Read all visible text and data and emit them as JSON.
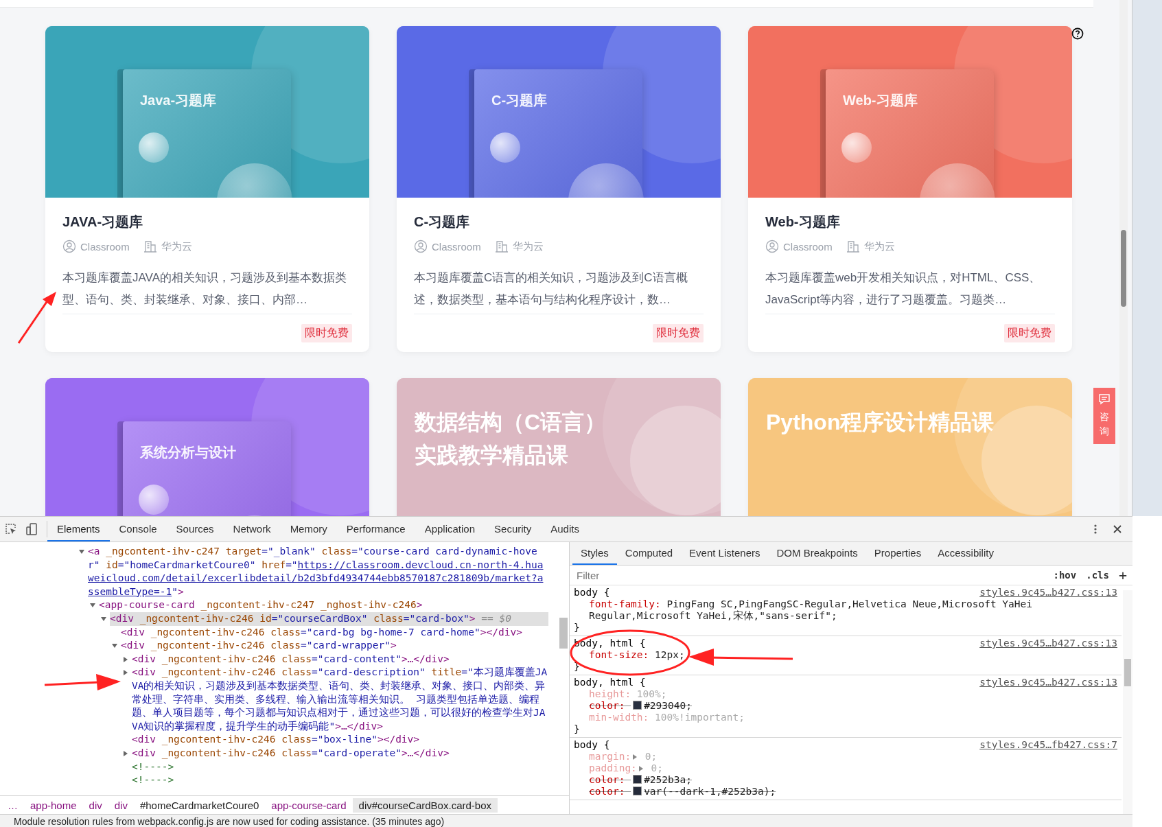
{
  "cards": [
    {
      "cover_lines": [
        "Java-习题库"
      ],
      "color": "#3aa5b8",
      "title": "JAVA-习题库",
      "author": "Classroom",
      "org": "华为云",
      "description": "本习题库覆盖JAVA的相关知识，习题涉及到基本数据类型、语句、类、封装继承、对象、接口、内部…",
      "badge": "限时免费"
    },
    {
      "cover_lines": [
        "C-习题库"
      ],
      "color": "#5a6ae6",
      "title": "C-习题库",
      "author": "Classroom",
      "org": "华为云",
      "description": "本习题库覆盖C语言的相关知识，习题涉及到C语言概述，数据类型，基本语句与结构化程序设计，数…",
      "badge": "限时免费"
    },
    {
      "cover_lines": [
        "Web-习题库"
      ],
      "color": "#f2705f",
      "title": "Web-习题库",
      "author": "Classroom",
      "org": "华为云",
      "description": "本习题库覆盖web开发相关知识点，对HTML、CSS、JavaScript等内容，进行了习题覆盖。习题类…",
      "badge": "限时免费"
    },
    {
      "cover_lines": [
        "系统分析与设计"
      ],
      "color": "#9a6cf2"
    },
    {
      "cover_lines": [
        "数据结构（C语言）",
        "实践教学精品课"
      ],
      "color": "#dcb8c2"
    },
    {
      "cover_lines": [
        "Python程序设计精品课"
      ],
      "color": "#f7c67f"
    }
  ],
  "consult_button": {
    "label": "咨询"
  },
  "devtools": {
    "tabs": [
      {
        "label": "Elements",
        "selected": true
      },
      {
        "label": "Console",
        "selected": false
      },
      {
        "label": "Sources",
        "selected": false
      },
      {
        "label": "Network",
        "selected": false
      },
      {
        "label": "Memory",
        "selected": false
      },
      {
        "label": "Performance",
        "selected": false
      },
      {
        "label": "Application",
        "selected": false
      },
      {
        "label": "Security",
        "selected": false
      },
      {
        "label": "Audits",
        "selected": false
      }
    ],
    "dom_tree": [
      {
        "kind": "element",
        "expanded": true,
        "selected": false,
        "parts": [
          {
            "kind": "tag",
            "text": "<a"
          },
          {
            "kind": "attr",
            "text": " _ngcontent-ihv-c247"
          },
          {
            "kind": "attr",
            "text": " target"
          },
          {
            "kind": "value",
            "text": "=\"_blank\""
          },
          {
            "kind": "attr",
            "text": " class"
          },
          {
            "kind": "value",
            "text": "=\"course-card card-dynamic-hover\""
          },
          {
            "kind": "attr",
            "text": " id"
          },
          {
            "kind": "value",
            "text": "=\"homeCardmarketCoure0\""
          },
          {
            "kind": "attr",
            "text": " href"
          },
          {
            "kind": "value",
            "text": "=\""
          },
          {
            "kind": "link",
            "text": "https://classroom.devcloud.cn-north-4.huaweicloud.com/detail/excerlibdetail/b2d3bfd4934744ebb8570187c281809b/market?assembleType=-1"
          },
          {
            "kind": "value",
            "text": "\""
          },
          {
            "kind": "tag",
            "text": ">"
          }
        ],
        "children": [
          {
            "kind": "element",
            "expanded": true,
            "selected": false,
            "parts": [
              {
                "kind": "tag",
                "text": "<app-course-card"
              },
              {
                "kind": "attr",
                "text": " _ngcontent-ihv-c247"
              },
              {
                "kind": "attr",
                "text": " _nghost-ihv-c246"
              },
              {
                "kind": "tag",
                "text": ">"
              }
            ],
            "children": [
              {
                "kind": "element",
                "expanded": true,
                "selected": true,
                "parts": [
                  {
                    "kind": "tag",
                    "text": "<div"
                  },
                  {
                    "kind": "attr",
                    "text": " _ngcontent-ihv-c246"
                  },
                  {
                    "kind": "attr",
                    "text": " id"
                  },
                  {
                    "kind": "value",
                    "text": "=\"courseCardBox\""
                  },
                  {
                    "kind": "attr",
                    "text": " class"
                  },
                  {
                    "kind": "value",
                    "text": "=\"card-box\""
                  },
                  {
                    "kind": "tag",
                    "text": ">"
                  },
                  {
                    "kind": "marker",
                    "text": " == $0"
                  }
                ],
                "children": [
                  {
                    "kind": "leaf",
                    "selected": false,
                    "parts": [
                      {
                        "kind": "tag",
                        "text": "<div"
                      },
                      {
                        "kind": "attr",
                        "text": " _ngcontent-ihv-c246"
                      },
                      {
                        "kind": "attr",
                        "text": " class"
                      },
                      {
                        "kind": "value",
                        "text": "=\"card-bg bg-home-7 card-home\""
                      },
                      {
                        "kind": "tag",
                        "text": "></div>"
                      }
                    ]
                  },
                  {
                    "kind": "element",
                    "expanded": true,
                    "selected": false,
                    "parts": [
                      {
                        "kind": "tag",
                        "text": "<div"
                      },
                      {
                        "kind": "attr",
                        "text": " _ngcontent-ihv-c246"
                      },
                      {
                        "kind": "attr",
                        "text": " class"
                      },
                      {
                        "kind": "value",
                        "text": "=\"card-wrapper\""
                      },
                      {
                        "kind": "tag",
                        "text": ">"
                      }
                    ],
                    "children": [
                      {
                        "kind": "element",
                        "expanded": false,
                        "selected": false,
                        "parts": [
                          {
                            "kind": "tag",
                            "text": "<div"
                          },
                          {
                            "kind": "attr",
                            "text": " _ngcontent-ihv-c246"
                          },
                          {
                            "kind": "attr",
                            "text": " class"
                          },
                          {
                            "kind": "value",
                            "text": "=\"card-content\""
                          },
                          {
                            "kind": "tag",
                            "text": ">…</div>"
                          }
                        ]
                      },
                      {
                        "kind": "element",
                        "expanded": false,
                        "selected": false,
                        "parts": [
                          {
                            "kind": "tag",
                            "text": "<div"
                          },
                          {
                            "kind": "attr",
                            "text": " _ngcontent-ihv-c246"
                          },
                          {
                            "kind": "attr",
                            "text": " class"
                          },
                          {
                            "kind": "value",
                            "text": "=\"card-description\""
                          },
                          {
                            "kind": "attr",
                            "text": " title"
                          },
                          {
                            "kind": "value",
                            "text": "=\"本习题库覆盖JAVA的相关知识，习题涉及到基本数据类型、语句、类、封装继承、对象、接口、内部类、异常处理、字符串、实用类、多线程、输入输出流等相关知识。 习题类型包括单选题、编程题、单人项目题等，每个习题都与知识点相对于，通过这些习题，可以很好的检查学生对JAVA知识的掌握程度，提升学生的动手编码能\""
                          },
                          {
                            "kind": "tag",
                            "text": ">…</div>"
                          }
                        ]
                      },
                      {
                        "kind": "leaf",
                        "selected": false,
                        "parts": [
                          {
                            "kind": "tag",
                            "text": "<div"
                          },
                          {
                            "kind": "attr",
                            "text": " _ngcontent-ihv-c246"
                          },
                          {
                            "kind": "attr",
                            "text": " class"
                          },
                          {
                            "kind": "value",
                            "text": "=\"box-line\""
                          },
                          {
                            "kind": "tag",
                            "text": "></div>"
                          }
                        ]
                      },
                      {
                        "kind": "element",
                        "expanded": false,
                        "selected": false,
                        "parts": [
                          {
                            "kind": "tag",
                            "text": "<div"
                          },
                          {
                            "kind": "attr",
                            "text": " _ngcontent-ihv-c246"
                          },
                          {
                            "kind": "attr",
                            "text": " class"
                          },
                          {
                            "kind": "value",
                            "text": "=\"card-operate\""
                          },
                          {
                            "kind": "tag",
                            "text": ">…</div>"
                          }
                        ]
                      },
                      {
                        "kind": "comment",
                        "selected": false,
                        "parts": [
                          {
                            "kind": "comment",
                            "text": "<!---->"
                          }
                        ]
                      },
                      {
                        "kind": "comment",
                        "selected": false,
                        "parts": [
                          {
                            "kind": "comment",
                            "text": "<!---->"
                          }
                        ]
                      }
                    ]
                  }
                ]
              }
            ]
          }
        ]
      }
    ],
    "breadcrumbs": [
      {
        "label": "…",
        "kind": "tag",
        "selected": false
      },
      {
        "label": "app-home",
        "kind": "tag",
        "selected": false
      },
      {
        "label": "div",
        "kind": "tag",
        "selected": false
      },
      {
        "label": "div",
        "kind": "tag",
        "selected": false
      },
      {
        "label": "#homeCardmarketCoure0",
        "kind": "id",
        "selected": false
      },
      {
        "label": "app-course-card",
        "kind": "tag",
        "selected": false
      },
      {
        "label": "div#courseCardBox.card-box",
        "kind": "id",
        "selected": true
      }
    ],
    "side_tabs": [
      {
        "label": "Styles",
        "selected": true
      },
      {
        "label": "Computed",
        "selected": false
      },
      {
        "label": "Event Listeners",
        "selected": false
      },
      {
        "label": "DOM Breakpoints",
        "selected": false
      },
      {
        "label": "Properties",
        "selected": false
      },
      {
        "label": "Accessibility",
        "selected": false
      }
    ],
    "filter": {
      "placeholder": "Filter",
      "hov": ":hov",
      "cls": ".cls",
      "add": "+"
    },
    "rules": [
      {
        "selector": "body {",
        "source": "styles.9c45…b427.css:13",
        "close": "}",
        "props": [
          {
            "name": "font-family:",
            "value": "PingFang SC,PingFangSC-Regular,Helvetica Neue,Microsoft YaHei Regular,Microsoft YaHei,宋体,\"sans-serif\";",
            "dimmed": false,
            "overridden": false
          }
        ]
      },
      {
        "selector": "body, html {",
        "source": "styles.9c45…b427.css:13",
        "close": "}",
        "props": [
          {
            "name": "font-size:",
            "value": "12px;",
            "dimmed": false,
            "overridden": false
          }
        ]
      },
      {
        "selector": "body, html {",
        "source": "styles.9c45…b427.css:13",
        "close": "}",
        "props": [
          {
            "name": "height:",
            "value": "100%;",
            "dimmed": true,
            "overridden": false
          },
          {
            "name": "color:",
            "value": "#293040;",
            "swatch": true,
            "dimmed": false,
            "overridden": true
          },
          {
            "name": "min-width:",
            "value": "100%!important;",
            "dimmed": true,
            "overridden": false
          }
        ]
      },
      {
        "selector": "body {",
        "source": "styles.9c45…fb427.css:7",
        "props": [
          {
            "name": "margin:",
            "value": "0;",
            "expandable": true,
            "dimmed": true,
            "overridden": false
          },
          {
            "name": "padding:",
            "value": "0;",
            "expandable": true,
            "dimmed": true,
            "overridden": false
          },
          {
            "name": "color:",
            "value": "#252b3a;",
            "swatch": true,
            "dimmed": false,
            "overridden": true
          },
          {
            "name": "color:",
            "value": "var(--dark-1,#252b3a);",
            "swatch": true,
            "dimmed": false,
            "overridden": true
          }
        ]
      }
    ]
  },
  "status_bar": {
    "message": "Module resolution rules from webpack.config.js are now used for coding assistance. (35 minutes ago)"
  }
}
